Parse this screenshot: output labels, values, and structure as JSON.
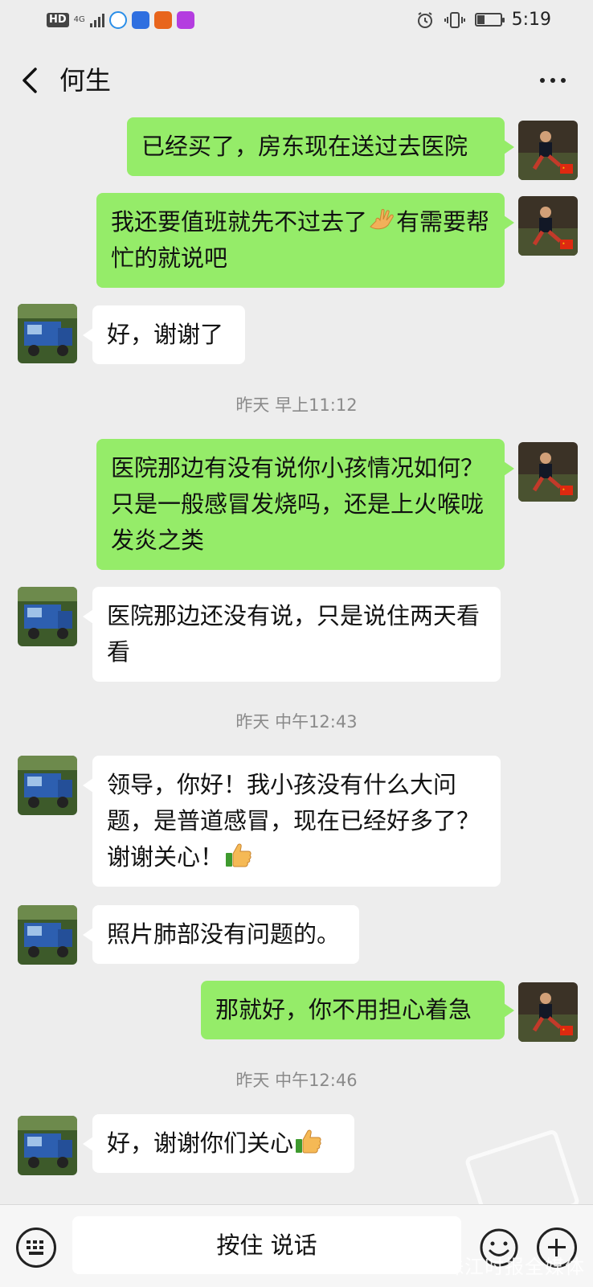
{
  "status_bar": {
    "hd": "HD",
    "network": "4G",
    "time": "5:19",
    "battery_level": 0.35
  },
  "nav": {
    "title": "何生"
  },
  "messages": [
    {
      "side": "me",
      "text": "已经买了，房东现在送过去医院"
    },
    {
      "side": "me",
      "text": "我还要值班就先不过去了",
      "emoji": "ok-hand-emoji",
      "text_after": "有需要帮忙的就说吧"
    },
    {
      "side": "other",
      "text": "好，谢谢了"
    },
    {
      "type": "time",
      "text": "昨天 早上11:12"
    },
    {
      "side": "me",
      "text": "医院那边有没有说你小孩情况如何？只是一般感冒发烧吗，还是上火喉咙发炎之类"
    },
    {
      "side": "other",
      "text": "医院那边还没有说，只是说住两天看看"
    },
    {
      "type": "time",
      "text": "昨天 中午12:43"
    },
    {
      "side": "other",
      "text": "领导，你好！我小孩没有什么大问题，是普道感冒，现在已经好多了？谢谢关心！",
      "emoji": "thumbs-up-emoji"
    },
    {
      "side": "other",
      "text": "照片肺部没有问题的。"
    },
    {
      "side": "me",
      "text": "那就好，你不用担心着急"
    },
    {
      "type": "time",
      "text": "昨天 中午12:46"
    },
    {
      "side": "other",
      "text": "好，谢谢你们关心",
      "emoji": "thumbs-up-emoji"
    }
  ],
  "bottom_bar": {
    "hold_to_talk": "按住 说话"
  },
  "watermark": "珠江时报全媒体",
  "colors": {
    "background": "#ededed",
    "my_bubble": "#95ec69",
    "other_bubble": "#ffffff",
    "timestamp": "#8a8a8a"
  }
}
